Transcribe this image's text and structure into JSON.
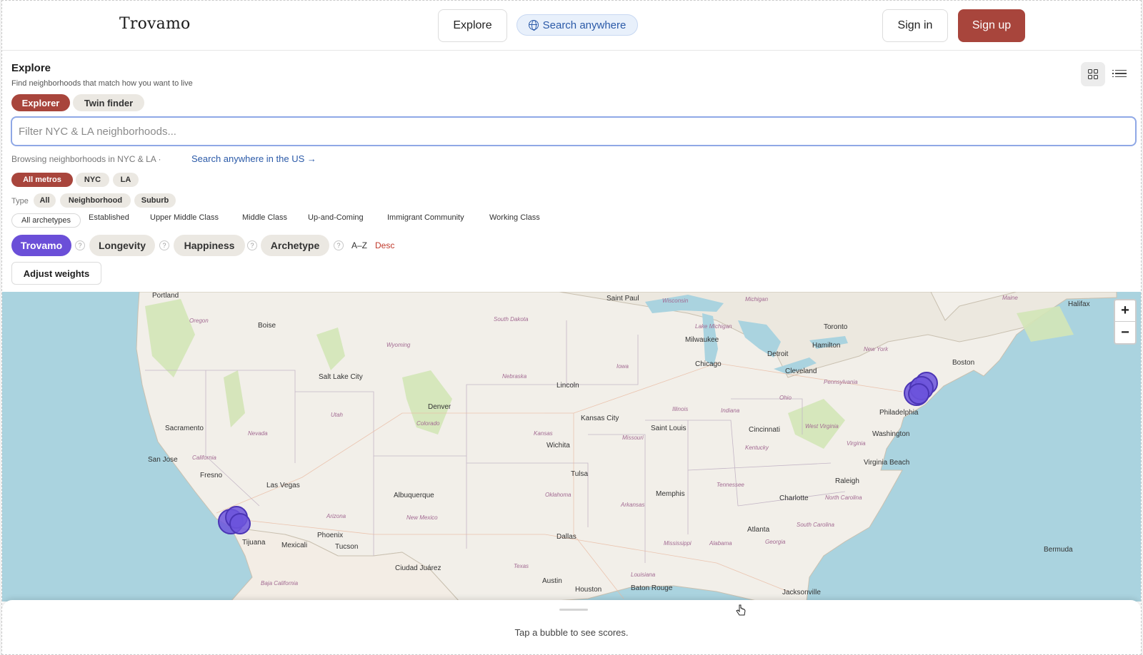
{
  "header": {
    "brand": "Trovamo",
    "explore": "Explore",
    "search_anywhere": "Search anywhere",
    "sign_in": "Sign in",
    "sign_up": "Sign up"
  },
  "panel": {
    "title": "Explore",
    "subtitle": "Find neighborhoods that match how you want to live",
    "modes": [
      "Explorer",
      "Twin finder"
    ],
    "filter_placeholder": "Filter NYC & LA neighborhoods...",
    "browsing_text": "Browsing neighborhoods in NYC & LA  ·",
    "browsing_link": "Search anywhere in the US →",
    "metros": [
      "All metros",
      "NYC",
      "LA"
    ],
    "type_label": "Type",
    "types": [
      "All",
      "Neighborhood",
      "Suburb"
    ],
    "archetypes": [
      "All archetypes",
      "Established",
      "Upper Middle Class",
      "Middle Class",
      "Up-and-Coming",
      "Immigrant Community",
      "Working Class"
    ],
    "sorts": [
      "Trovamo",
      "Longevity",
      "Happiness",
      "Archetype"
    ],
    "sort_az": "A–Z",
    "sort_desc": "Desc",
    "help_glyph": "?",
    "adjust_weights": "Adjust weights"
  },
  "map": {
    "zoom_in": "+",
    "zoom_out": "−",
    "cities": [
      "Portland",
      "Boise",
      "Salt Lake City",
      "Sacramento",
      "San Jose",
      "Fresno",
      "Las Vegas",
      "Denver",
      "Albuquerque",
      "Phoenix",
      "Tucson",
      "Mexicali",
      "Tijuana",
      "Ciudad Juárez",
      "Saint Paul",
      "Lincoln",
      "Kansas City",
      "Wichita",
      "Tulsa",
      "Dallas",
      "Austin",
      "Houston",
      "Baton Rouge",
      "Saint Louis",
      "Memphis",
      "Milwaukee",
      "Chicago",
      "Detroit",
      "Cleveland",
      "Cincinnati",
      "Toronto",
      "Hamilton",
      "Boston",
      "Philadelphia",
      "Washington",
      "Virginia Beach",
      "Raleigh",
      "Charlotte",
      "Atlanta",
      "Jacksonville",
      "Halifax",
      "Bermuda"
    ],
    "states": [
      "Oregon",
      "California",
      "Nevada",
      "Utah",
      "Wyoming",
      "Colorado",
      "Arizona",
      "New Mexico",
      "South Dakota",
      "Nebraska",
      "Kansas",
      "Oklahoma",
      "Texas",
      "Iowa",
      "Missouri",
      "Arkansas",
      "Louisiana",
      "Mississippi",
      "Alabama",
      "Georgia",
      "Illinois",
      "Indiana",
      "Ohio",
      "Kentucky",
      "Tennessee",
      "West Virginia",
      "Virginia",
      "North Carolina",
      "South Carolina",
      "Pennsylvania",
      "New York",
      "Wisconsin",
      "Michigan",
      "Lake Michigan",
      "Baja California",
      "Maine"
    ]
  },
  "sheet": {
    "hint": "Tap a bubble to see scores."
  },
  "colors": {
    "accent_red": "#a8453c",
    "accent_purple": "#6b4fd8",
    "link_blue": "#2b5aa8",
    "water": "#aad3df",
    "land": "#f2efe9"
  }
}
